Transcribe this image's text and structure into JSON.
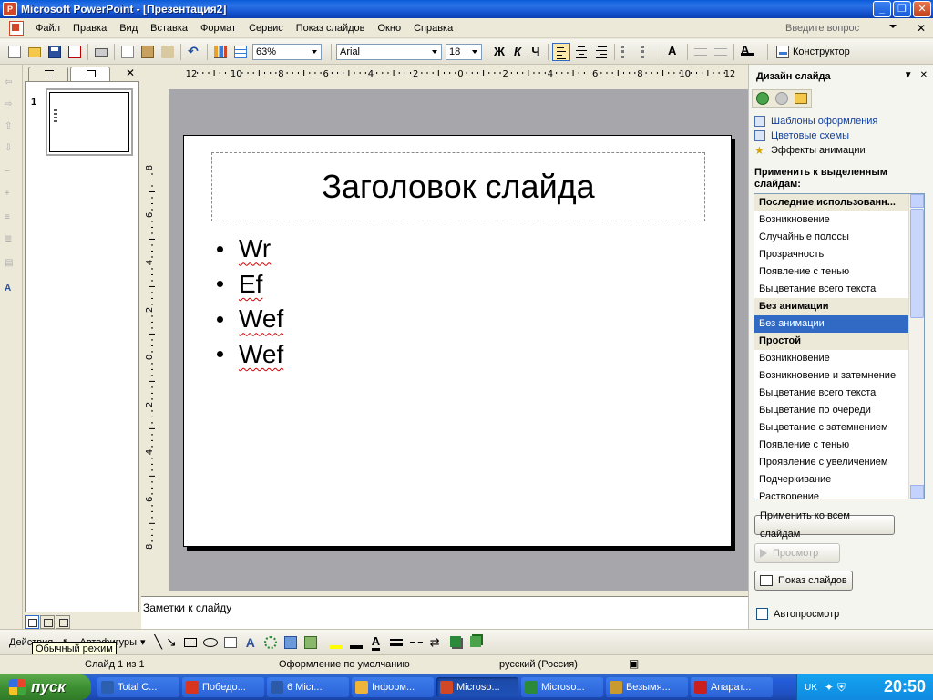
{
  "window": {
    "title": "Microsoft PowerPoint - [Презентация2]"
  },
  "menu": {
    "items": [
      "Файл",
      "Правка",
      "Вид",
      "Вставка",
      "Формат",
      "Сервис",
      "Показ слайдов",
      "Окно",
      "Справка"
    ],
    "help_placeholder": "Введите вопрос"
  },
  "toolbar": {
    "zoom": "63%",
    "font": "Arial",
    "font_size": "18",
    "bold": "Ж",
    "italic": "К",
    "underline": "Ч",
    "designer": "Конструктор"
  },
  "ruler": {
    "horizontal_labels": [
      "12",
      "10",
      "8",
      "6",
      "4",
      "2",
      "0",
      "2",
      "4",
      "6",
      "8",
      "10",
      "12"
    ],
    "vertical_labels": [
      "8",
      "6",
      "4",
      "2",
      "0",
      "2",
      "4",
      "6",
      "8"
    ]
  },
  "slides_pane": {
    "slide_number": "1"
  },
  "slide": {
    "title": "Заголовок слайда",
    "bullets": [
      "Wr",
      "Ef",
      "Wef",
      "Wef"
    ]
  },
  "notes": {
    "placeholder": "Заметки к слайду"
  },
  "task_pane": {
    "title": "Дизайн слайда",
    "links": [
      "Шаблоны оформления",
      "Цветовые схемы",
      "Эффекты анимации"
    ],
    "apply_label": "Применить к выделенным слайдам:",
    "animations": [
      {
        "label": "Последние использованн...",
        "kind": "header"
      },
      {
        "label": "Возникновение",
        "kind": "item"
      },
      {
        "label": "Случайные полосы",
        "kind": "item"
      },
      {
        "label": "Прозрачность",
        "kind": "item"
      },
      {
        "label": "Появление с тенью",
        "kind": "item"
      },
      {
        "label": "Выцветание всего текста",
        "kind": "item"
      },
      {
        "label": "Без анимации",
        "kind": "header"
      },
      {
        "label": "Без анимации",
        "kind": "selected"
      },
      {
        "label": "Простой",
        "kind": "header"
      },
      {
        "label": "Возникновение",
        "kind": "item"
      },
      {
        "label": "Возникновение и затемнение",
        "kind": "item"
      },
      {
        "label": "Выцветание всего текста",
        "kind": "item"
      },
      {
        "label": "Выцветание по очереди",
        "kind": "item"
      },
      {
        "label": "Выцветание с затемнением",
        "kind": "item"
      },
      {
        "label": "Появление с тенью",
        "kind": "item"
      },
      {
        "label": "Проявление с увеличением",
        "kind": "item"
      },
      {
        "label": "Подчеркивание",
        "kind": "item"
      },
      {
        "label": "Растворение",
        "kind": "item"
      }
    ],
    "apply_all_button": "Применить ко всем слайдам",
    "preview_button": "Просмотр",
    "slideshow_button": "Показ слайдов",
    "autopreview_label": "Автопросмотр"
  },
  "drawing_toolbar": {
    "actions": "Действия",
    "autoshapes": "Автофигуры",
    "tooltip": "Обычный режим"
  },
  "status_bar": {
    "slide_count": "Слайд 1 из 1",
    "design": "Оформление по умолчанию",
    "language": "русский (Россия)"
  },
  "taskbar": {
    "start": "пуск",
    "tasks": [
      {
        "label": "Total C...",
        "color": "#2d5fb0"
      },
      {
        "label": "Победо...",
        "color": "#d8341e"
      },
      {
        "label": "6 Micr...",
        "color": "#2b5aa8"
      },
      {
        "label": "Інформ...",
        "color": "#f0b43a"
      },
      {
        "label": "Microso...",
        "color": "#d24726",
        "active": true
      },
      {
        "label": "Microso...",
        "color": "#2a8a3a"
      },
      {
        "label": "Безымя...",
        "color": "#c89a30"
      },
      {
        "label": "Апарат...",
        "color": "#c8201e"
      }
    ],
    "lang": "UK",
    "clock": "20:50"
  }
}
